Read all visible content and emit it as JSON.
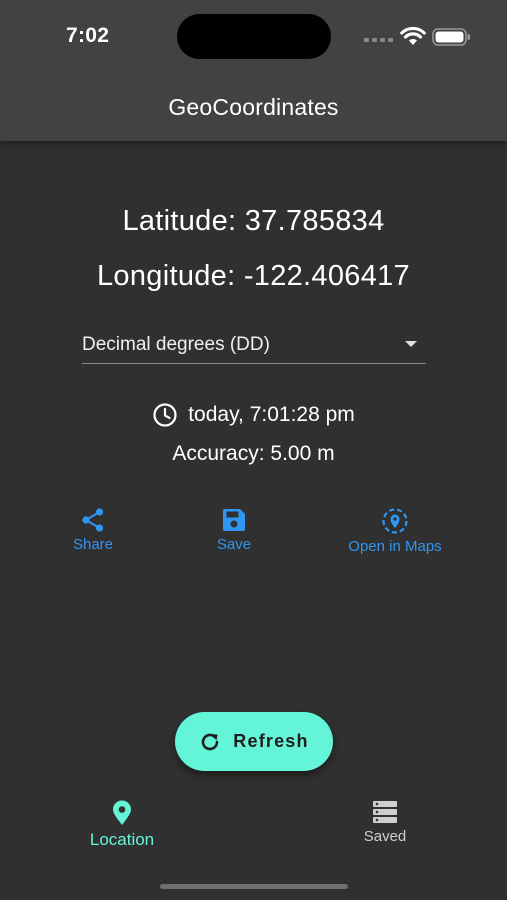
{
  "status_bar": {
    "time": "7:02"
  },
  "app_bar": {
    "title": "GeoCoordinates"
  },
  "coordinates": {
    "latitude_label": "Latitude: 37.785834",
    "longitude_label": "Longitude: -122.406417"
  },
  "format_select": {
    "selected": "Decimal degrees (DD)"
  },
  "details": {
    "timestamp": "today, 7:01:28 pm",
    "accuracy": "Accuracy: 5.00 m"
  },
  "actions": {
    "share_label": "Share",
    "save_label": "Save",
    "maps_label": "Open in Maps"
  },
  "refresh_button": {
    "label": "Refresh"
  },
  "bottom_nav": {
    "items": [
      {
        "label": "Location",
        "icon": "map-pin-icon",
        "active": true
      },
      {
        "label": "Saved",
        "icon": "storage-icon",
        "active": false
      }
    ]
  },
  "colors": {
    "background": "#303030",
    "app_bar": "#424242",
    "accent": "#64f5d8",
    "action_blue": "#2f96f3"
  }
}
